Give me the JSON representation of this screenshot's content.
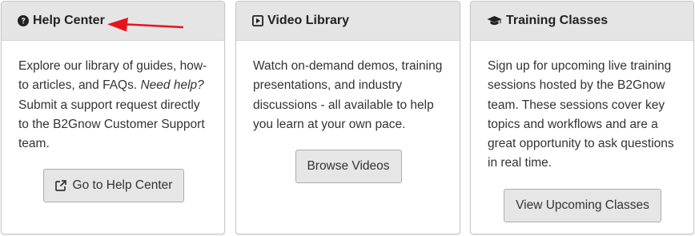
{
  "cards": {
    "help": {
      "title": "Help Center",
      "icon": "question-circle-icon",
      "text_before": "Explore our library of guides, how-to articles, and FAQs. ",
      "text_emphasis": "Need help?",
      "text_after": " Submit a support request directly to the B2Gnow Customer Support team.",
      "button_label": "Go to Help Center",
      "button_icon": "external-link-icon"
    },
    "video": {
      "title": "Video Library",
      "icon": "play-square-icon",
      "text": "Watch on-demand demos, training presentations, and industry discussions - all available to help you learn at your own pace.",
      "button_label": "Browse Videos"
    },
    "training": {
      "title": "Training Classes",
      "icon": "graduation-cap-icon",
      "text": "Sign up for upcoming live training sessions hosted by the B2Gnow team. These sessions cover key topics and workflows and are a great opportunity to ask questions in real time.",
      "button_label": "View Upcoming Classes"
    }
  },
  "annotation": {
    "icon": "red-arrow-icon",
    "color": "#e8141b"
  },
  "colors": {
    "header_bg": "#e5e5e6",
    "button_bg": "#e6e6e6",
    "border": "#c9c9c9",
    "text": "#333333"
  }
}
